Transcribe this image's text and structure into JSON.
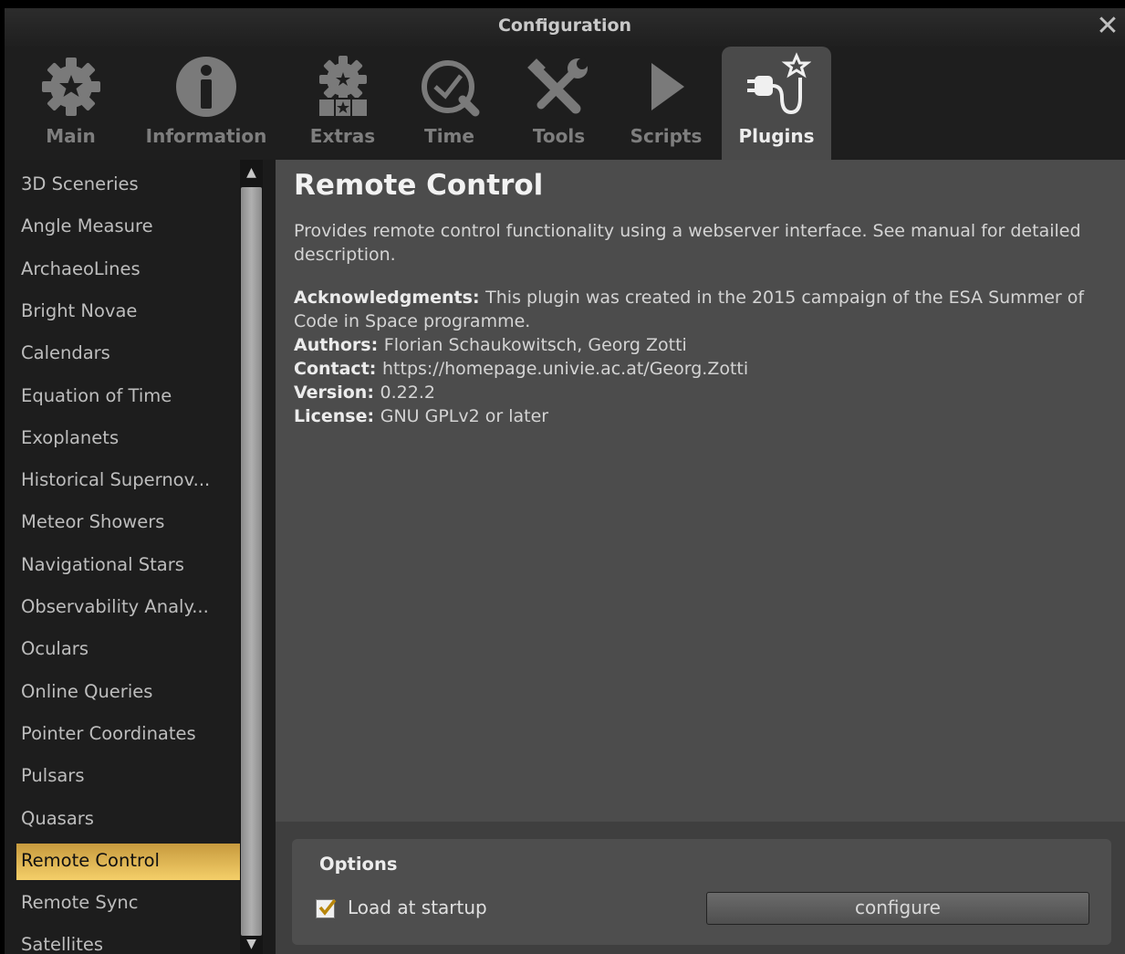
{
  "window": {
    "title": "Configuration",
    "close_label": "✕"
  },
  "tabs": [
    {
      "label": "Main"
    },
    {
      "label": "Information"
    },
    {
      "label": "Extras"
    },
    {
      "label": "Time"
    },
    {
      "label": "Tools"
    },
    {
      "label": "Scripts"
    },
    {
      "label": "Plugins",
      "active": true
    }
  ],
  "plugins": [
    "3D Sceneries",
    "Angle Measure",
    "ArchaeoLines",
    "Bright Novae",
    "Calendars",
    "Equation of Time",
    "Exoplanets",
    "Historical Supernov...",
    "Meteor Showers",
    "Navigational Stars",
    "Observability Analy...",
    "Oculars",
    "Online Queries",
    "Pointer Coordinates",
    "Pulsars",
    "Quasars",
    "Remote Control",
    "Remote Sync",
    "Satellites"
  ],
  "selected_plugin": "Remote Control",
  "detail": {
    "title": "Remote Control",
    "description": "Provides remote control functionality using a webserver interface. See manual for detailed description.",
    "acknowledgments_label": "Acknowledgments",
    "acknowledgments": "This plugin was created in the 2015 campaign of the ESA Summer of Code in Space programme.",
    "authors_label": "Authors",
    "authors": "Florian Schaukowitsch, Georg Zotti",
    "contact_label": "Contact",
    "contact": "https://homepage.univie.ac.at/Georg.Zotti",
    "version_label": "Version",
    "version": "0.22.2",
    "license_label": "License",
    "license": "GNU GPLv2 or later"
  },
  "options": {
    "title": "Options",
    "load_at_startup_label": "Load at startup",
    "load_at_startup": true,
    "configure_label": "configure"
  },
  "colors": {
    "selected_gradient_top": "#c79a3e",
    "selected_gradient_bottom": "#f4cf69",
    "active_tab": "#4a4a4a"
  }
}
